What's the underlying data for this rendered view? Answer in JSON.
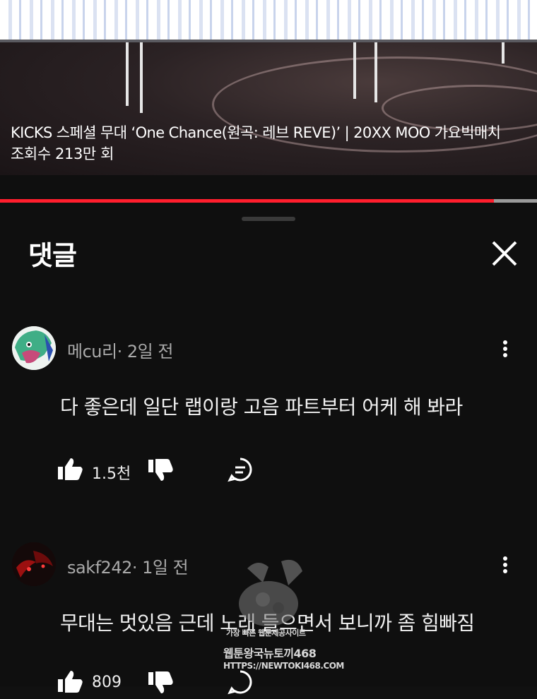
{
  "video": {
    "caption": "KICKS 스페셜 무대 ‘One Chance(원곡: 레브 REVE)’ | 20XX MOO 가요빅매치",
    "views": "조회수 213만 회",
    "progress": 0.92
  },
  "colors": {
    "progress_fill": "#ff1e2d",
    "background": "#0f0f0f",
    "meta_text": "#aaaaaa"
  },
  "comments_sheet": {
    "title": "댓글",
    "close_icon": "close-icon"
  },
  "comments": [
    {
      "author": "메cu리",
      "age": "· 2일 전",
      "text": "다 좋은데 일단 랩이랑 고음 파트부터 어케 해 봐라",
      "likes": "1.5천"
    },
    {
      "author": "sakf242",
      "age": "· 1일 전",
      "text": "무대는 멋있음 근데 노래 들으면서 보니까 좀 힘빠짐",
      "likes": "809"
    }
  ],
  "watermark": {
    "line1": "가장 빠른 웹툰제공사이트",
    "line2": "웹툰왕국뉴토끼468",
    "line3": "HTTPS://NEWTOKI468.COM"
  }
}
